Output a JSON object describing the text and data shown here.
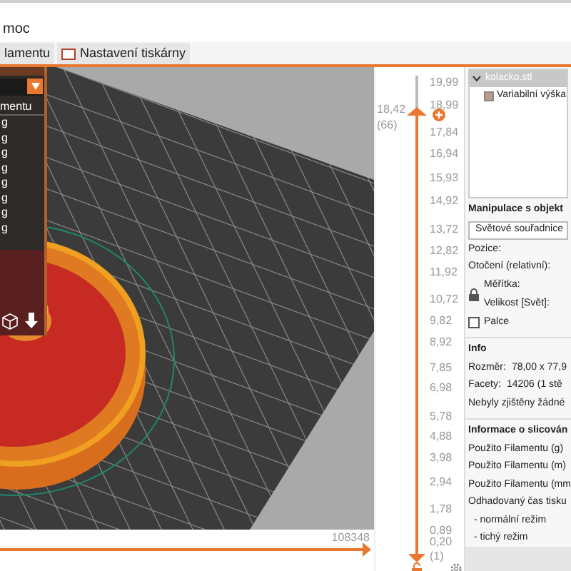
{
  "menu": {
    "item": "moc"
  },
  "tabs": [
    {
      "label": "lamentu",
      "selected": false,
      "icon": false
    },
    {
      "label": "Nastavení tiskárny",
      "selected": false,
      "icon": true
    }
  ],
  "legend": {
    "header": "mentu",
    "rows": [
      "g",
      "g",
      "g",
      "g",
      "g",
      "g",
      "g",
      "g"
    ]
  },
  "vertical_slider": {
    "ticks": [
      "19,99",
      "18,99",
      "17,84",
      "16,94",
      "15,93",
      "14,92",
      "13,72",
      "12,82",
      "11,92",
      "10,72",
      "9,82",
      "8,92",
      "7,85",
      "6,98",
      "5,78",
      "4,88",
      "3,98",
      "2,94",
      "1,78",
      "0,89"
    ],
    "upper": {
      "value": "18,42",
      "layer": "(66)",
      "level": 0.92
    },
    "lower": {
      "value": "0,20",
      "layer": "(1)",
      "level": 0
    }
  },
  "horizontal_slider": {
    "value": "108348",
    "level": 1
  },
  "object_list": [
    {
      "name": "kolacko.stl",
      "selected": true,
      "expanded": true,
      "children": [
        {
          "name": "Variabilní výška",
          "selected": false
        }
      ]
    }
  ],
  "manipulation": {
    "title": "Manipulace s objekt",
    "coordinates": "Světové souřadnice",
    "position": "Pozice:",
    "rotation": "Otočení (relativní):",
    "scale": "Měřítka:",
    "size": "Velikost [Svět]:",
    "inches": {
      "label": "Palce",
      "checked": false
    }
  },
  "info": {
    "title": "Info",
    "rows": [
      {
        "label": "Rozměr:",
        "value": "78,00 x 77,9"
      },
      {
        "label": "Facety:",
        "value": "14206 (1 stě"
      }
    ],
    "note": "Nebyly zjištěny žádné"
  },
  "slicing": {
    "title": "Informace o slicován",
    "rows": [
      "Použito Filamentu (g)",
      "Použito Filamentu (m)",
      "Použito Filamentu (mm",
      "Odhadovaný čas tisku",
      "- normální režim",
      "- tichý režim"
    ]
  }
}
